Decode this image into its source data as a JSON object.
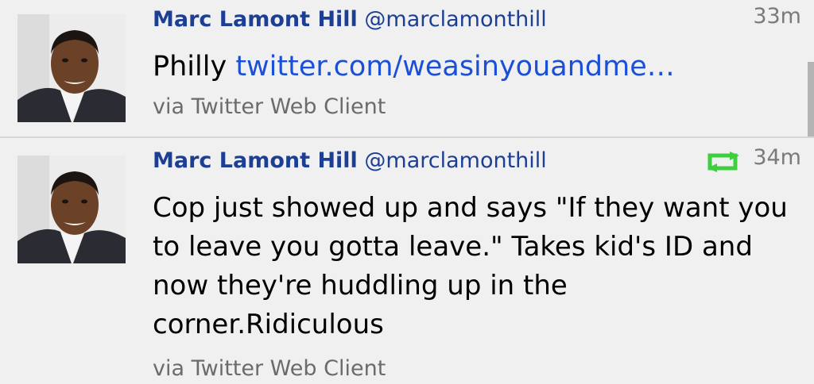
{
  "tweets": [
    {
      "author_name": "Marc Lamont Hill",
      "author_handle": "@marclamonthill",
      "timestamp": "33m",
      "text_prefix": "Philly ",
      "link_text": "twitter.com/weasinyouandme…",
      "source": "via Twitter Web Client",
      "avatar_icon": "profile-photo",
      "retweeted": false
    },
    {
      "author_name": "Marc Lamont Hill",
      "author_handle": "@marclamonthill",
      "timestamp": "34m",
      "text": "Cop just showed up and says \"If they want you to leave you gotta leave.\" Takes kid's ID and now they're huddling up in the corner.Ridiculous",
      "source": "via Twitter Web Client",
      "avatar_icon": "profile-photo",
      "retweeted": true,
      "retweet_icon": "retweet-icon",
      "retweet_color": "#3ecf3e"
    }
  ],
  "colors": {
    "name": "#1c3f94",
    "link": "#1a4fd8",
    "meta": "#7a7a7a",
    "background": "#f0f0f0"
  }
}
